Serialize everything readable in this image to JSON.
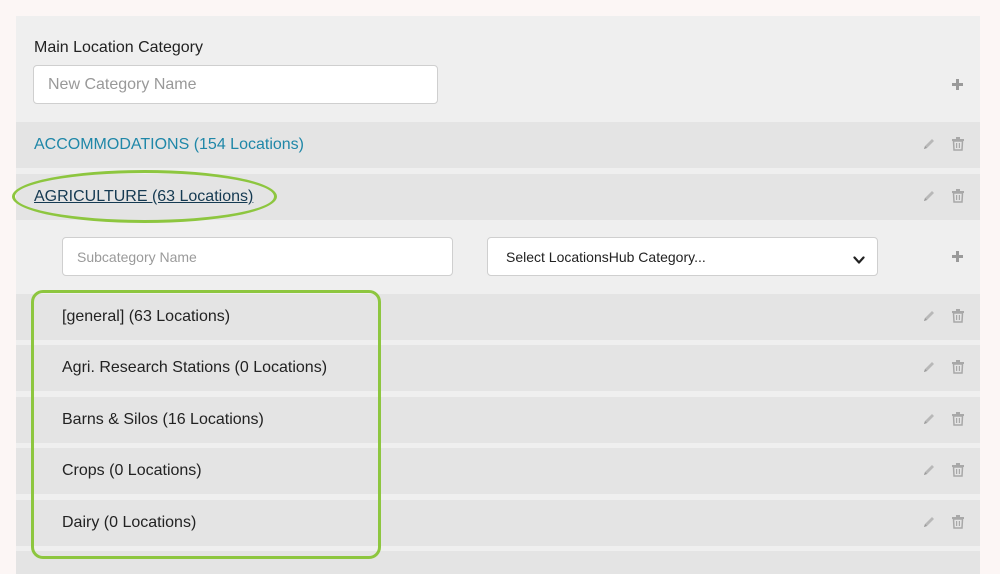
{
  "main": {
    "label": "Main Location Category",
    "new_category_placeholder": "New Category Name"
  },
  "categories": [
    {
      "label": "ACCOMMODATIONS (154 Locations)"
    },
    {
      "label": "AGRICULTURE (63 Locations)",
      "selected": true
    }
  ],
  "sub": {
    "name_placeholder": "Subcategory Name",
    "select_value": "Select LocationsHub Category..."
  },
  "subcategories": [
    {
      "label": "[general]  (63 Locations)"
    },
    {
      "label": "Agri. Research Stations  (0 Locations)"
    },
    {
      "label": "Barns & Silos  (16 Locations)"
    },
    {
      "label": "Crops  (0 Locations)"
    },
    {
      "label": "Dairy  (0 Locations)"
    }
  ],
  "icons": {
    "add": "plus-icon",
    "edit": "pencil-icon",
    "delete": "trash-icon",
    "dropdown": "chevron-down-icon"
  },
  "colors": {
    "link": "#1f87a8",
    "link_selected": "#153a52",
    "highlight": "#8dc63f",
    "row_bg": "#e4e4e4",
    "panel_bg": "#efefef"
  }
}
